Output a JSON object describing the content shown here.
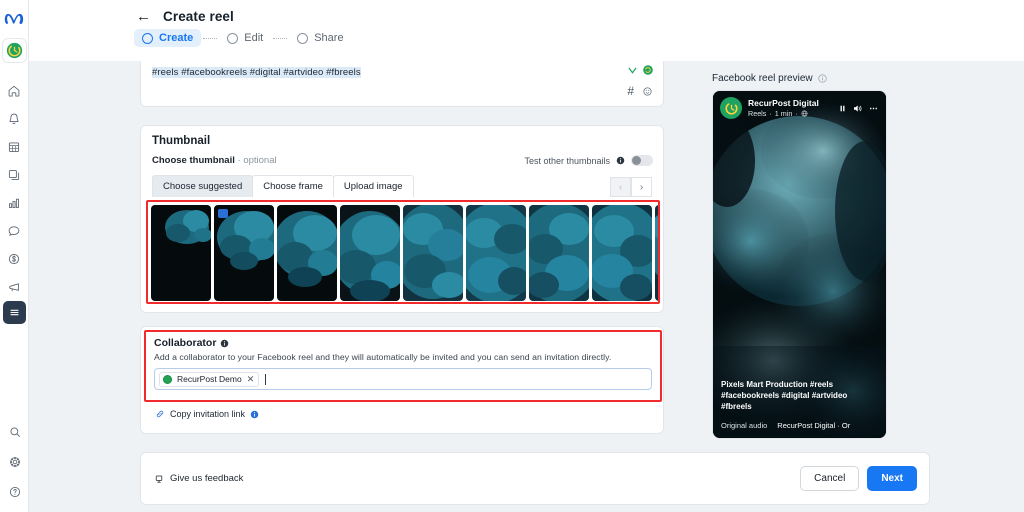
{
  "app": {
    "brand": "Meta",
    "product": "RecurPost"
  },
  "sidebar": {
    "items": [
      {
        "name": "home",
        "icon": "home-icon"
      },
      {
        "name": "notifications",
        "icon": "bell-icon"
      },
      {
        "name": "calendar",
        "icon": "calendar-icon"
      },
      {
        "name": "library",
        "icon": "pages-icon"
      },
      {
        "name": "analytics",
        "icon": "bar-chart-icon"
      },
      {
        "name": "inbox",
        "icon": "chat-bubble-icon"
      },
      {
        "name": "billing",
        "icon": "dollar-circle-icon"
      },
      {
        "name": "promote",
        "icon": "megaphone-icon"
      },
      {
        "name": "menu",
        "icon": "hamburger-icon",
        "active": true
      }
    ],
    "bottom": [
      {
        "name": "search",
        "icon": "search-icon"
      },
      {
        "name": "settings",
        "icon": "gear-icon"
      },
      {
        "name": "help",
        "icon": "help-circle-icon"
      }
    ]
  },
  "header": {
    "back_label": "←",
    "title": "Create reel"
  },
  "stepper": {
    "steps": [
      {
        "label": "Create",
        "active": true
      },
      {
        "label": "Edit",
        "active": false
      },
      {
        "label": "Share",
        "active": false
      }
    ]
  },
  "compose": {
    "hashtags": "#reels #facebookreels #digital #artvideo #fbreels",
    "hashtag_button": "#",
    "emoji_button": "☺"
  },
  "thumbnail": {
    "section_title": "Thumbnail",
    "choose_label": "Choose thumbnail",
    "choose_separator": "·",
    "optional_label": "optional",
    "test_toggle_label": "Test other thumbnails",
    "test_toggle_on": false,
    "tabs": [
      {
        "label": "Choose suggested",
        "selected": true
      },
      {
        "label": "Choose frame",
        "selected": false
      },
      {
        "label": "Upload image",
        "selected": false
      }
    ],
    "prev_arrow": "‹",
    "next_arrow": "›",
    "frames": [
      {
        "id": 1,
        "selected": false
      },
      {
        "id": 2,
        "selected": true
      },
      {
        "id": 3,
        "selected": false
      },
      {
        "id": 4,
        "selected": false
      },
      {
        "id": 5,
        "selected": false
      },
      {
        "id": 6,
        "selected": false
      },
      {
        "id": 7,
        "selected": false
      },
      {
        "id": 8,
        "selected": false
      },
      {
        "id": 9,
        "selected": false
      }
    ]
  },
  "collaborator": {
    "title": "Collaborator",
    "info_icon": "info-icon",
    "description": "Add a collaborator to your Facebook reel and they will automatically be invited and you can send an invitation directly.",
    "chips": [
      {
        "name": "RecurPost Demo",
        "remove": "✕"
      }
    ],
    "input_placeholder": "",
    "copy_link_label": "Copy invitation link"
  },
  "footer": {
    "feedback_label": "Give us feedback",
    "cancel_label": "Cancel",
    "next_label": "Next"
  },
  "preview": {
    "label": "Facebook reel preview",
    "account_name": "RecurPost Digital",
    "meta_type": "Reels",
    "meta_dot1": "·",
    "meta_time": "1 min",
    "meta_dot2": "·",
    "meta_globe": "globe-icon",
    "caption": "Pixels Mart Production #reels #facebookreels #digital #artvideo #fbreels",
    "audio_label": "Original audio",
    "audio_attribution": "RecurPost Digital · Or"
  },
  "colors": {
    "accent_blue": "#1878f3",
    "highlight_red": "#f12b2b",
    "page_bg": "#eef2f5",
    "brand_green": "#23a455"
  }
}
